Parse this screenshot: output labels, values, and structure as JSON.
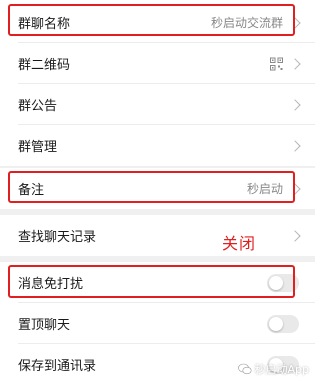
{
  "settings": {
    "group_name": {
      "label": "群聊名称",
      "value": "秒启动交流群"
    },
    "qr_code": {
      "label": "群二维码"
    },
    "announcement": {
      "label": "群公告"
    },
    "manage": {
      "label": "群管理"
    },
    "remark": {
      "label": "备注",
      "value": "秒启动"
    },
    "search_history": {
      "label": "查找聊天记录"
    },
    "mute": {
      "label": "消息免打扰",
      "on": false
    },
    "pin": {
      "label": "置顶聊天",
      "on": false
    },
    "save_contacts": {
      "label": "保存到通讯录",
      "on": false
    }
  },
  "annotation": {
    "text": "关闭"
  },
  "watermark": {
    "text": "秒启动App"
  },
  "colors": {
    "highlight": "#e02020",
    "toggle_off": "#e9e9e9",
    "separator": "#f0f0f0"
  }
}
